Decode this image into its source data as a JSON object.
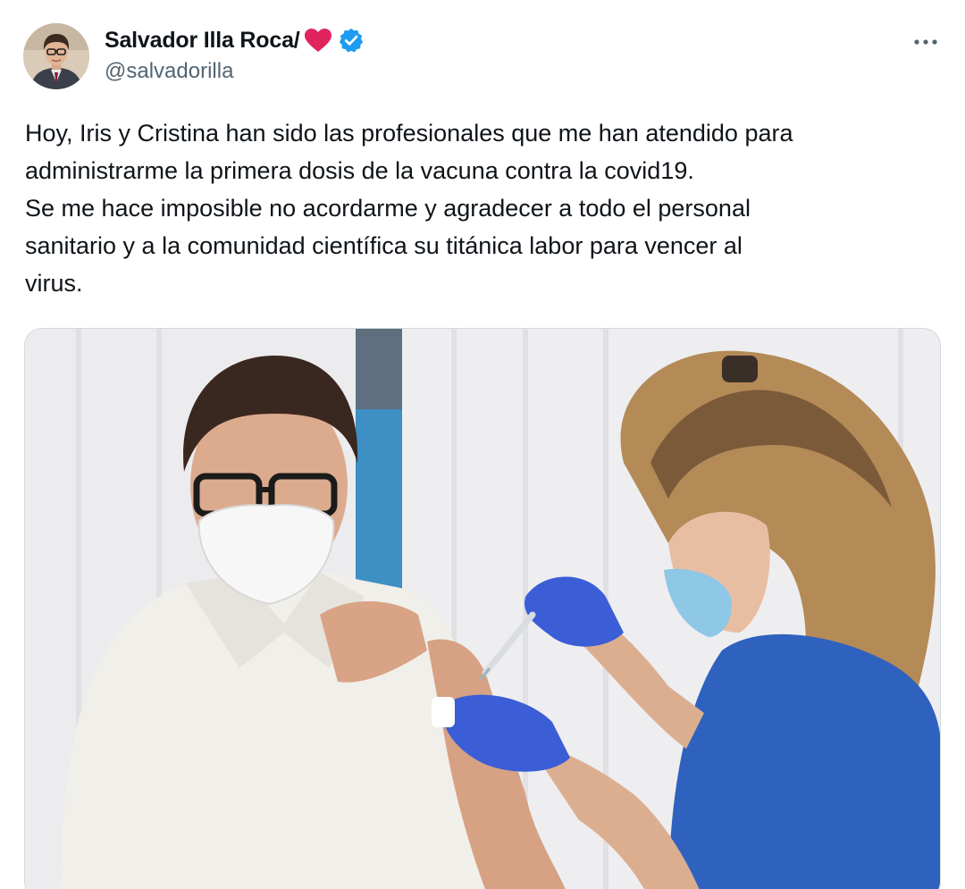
{
  "author": {
    "display_name": "Salvador Illa Roca/",
    "handle": "@salvadorilla",
    "avatar_icon": "user-avatar-photo",
    "name_emoji": "red-heart-icon",
    "verified_badge_color": "#1d9bf0"
  },
  "actions": {
    "more_icon": "more-options-icon"
  },
  "tweet": {
    "lines": [
      "Hoy, Iris y Cristina han sido las profesionales que me han atendido para",
      "administrarme la primera dosis de la vacuna contra la covid19.",
      "Se me hace imposible no acordarme y agradecer a todo el personal",
      "sanitario y a la comunidad científica su titánica labor para vencer al",
      "virus."
    ]
  },
  "media": {
    "type": "photo",
    "depiction": "vaccination-photo"
  },
  "colors": {
    "text_primary": "#0f1419",
    "text_secondary": "#536471",
    "accent": "#1d9bf0",
    "heart": "#e0245e"
  }
}
